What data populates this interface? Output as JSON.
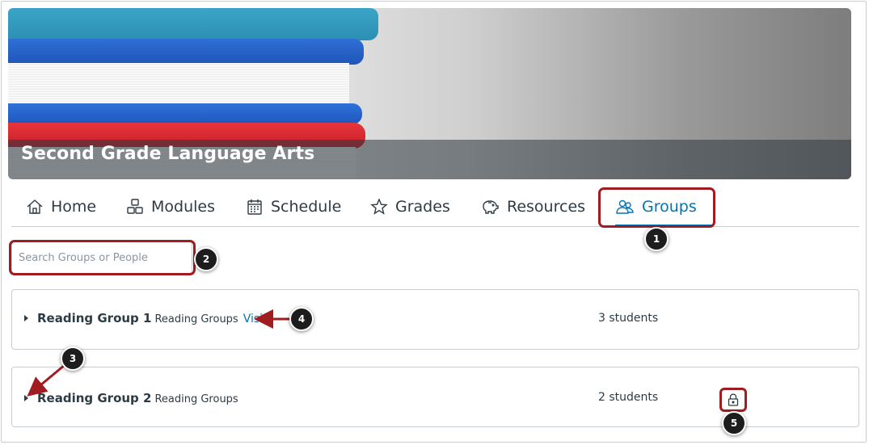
{
  "course": {
    "title": "Second Grade Language Arts"
  },
  "tabs": [
    {
      "label": "Home",
      "icon": "home-icon"
    },
    {
      "label": "Modules",
      "icon": "modules-icon"
    },
    {
      "label": "Schedule",
      "icon": "calendar-icon"
    },
    {
      "label": "Grades",
      "icon": "star-icon"
    },
    {
      "label": "Resources",
      "icon": "piggy-bank-icon"
    },
    {
      "label": "Groups",
      "icon": "groups-icon",
      "active": true
    }
  ],
  "search": {
    "placeholder": "Search Groups or People",
    "value": ""
  },
  "groups": [
    {
      "name": "Reading Group 1",
      "category": "Reading Groups",
      "visit_label": "Visit",
      "count": "3 students"
    },
    {
      "name": "Reading Group 2",
      "category": "Reading Groups",
      "count": "2 students",
      "icon": "lock-icon"
    }
  ],
  "markers": [
    "1",
    "2",
    "3",
    "4",
    "5"
  ],
  "colors": {
    "accent": "#0374b5",
    "highlight": "#a01c20",
    "text": "#2d3b45"
  }
}
